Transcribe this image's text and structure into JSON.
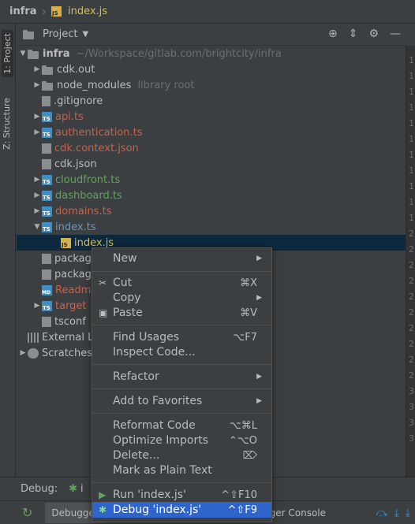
{
  "navbar": {
    "project": "infra",
    "file": "index.js"
  },
  "strip": {
    "project_tab": "1: Project",
    "structure_tab": "Z: Structure"
  },
  "project_panel": {
    "title": "Project"
  },
  "tree": [
    {
      "label": "infra",
      "hint": "~/Workspace/gitlab.com/brightcity/infra",
      "icon": "folder",
      "color": "#bbbbbb"
    },
    {
      "label": "cdk.out",
      "hint": "",
      "icon": "folder",
      "color": "#bbbbbb"
    },
    {
      "label": "node_modules",
      "hint": "library root",
      "icon": "folder",
      "color": "#bbbbbb"
    },
    {
      "label": ".gitignore",
      "hint": "",
      "icon": "blank",
      "color": "#bbbbbb"
    },
    {
      "label": "api.ts",
      "hint": "",
      "icon": "ts",
      "color": "#c7624b"
    },
    {
      "label": "authentication.ts",
      "hint": "",
      "icon": "ts",
      "color": "#c7624b"
    },
    {
      "label": "cdk.context.json",
      "hint": "",
      "icon": "json",
      "color": "#c7624b"
    },
    {
      "label": "cdk.json",
      "hint": "",
      "icon": "json",
      "color": "#bbbbbb"
    },
    {
      "label": "cloudfront.ts",
      "hint": "",
      "icon": "ts",
      "color": "#62a35c"
    },
    {
      "label": "dashboard.ts",
      "hint": "",
      "icon": "ts",
      "color": "#62a35c"
    },
    {
      "label": "domains.ts",
      "hint": "",
      "icon": "ts",
      "color": "#c7624b"
    },
    {
      "label": "index.ts",
      "hint": "",
      "icon": "ts",
      "color": "#6897bb"
    },
    {
      "label": "index.js",
      "hint": "",
      "icon": "js",
      "color": "#d6bf55"
    },
    {
      "label": "packag",
      "hint": "",
      "icon": "json",
      "color": "#bbbbbb"
    },
    {
      "label": "packag",
      "hint": "",
      "icon": "json",
      "color": "#bbbbbb"
    },
    {
      "label": "Readm",
      "hint": "",
      "icon": "md",
      "color": "#c7624b"
    },
    {
      "label": "target",
      "hint": "",
      "icon": "ts",
      "color": "#c7624b"
    },
    {
      "label": "tsconf",
      "hint": "",
      "icon": "json",
      "color": "#bbbbbb"
    },
    {
      "label": "External L",
      "hint": "",
      "icon": "lib",
      "color": "#bbbbbb"
    },
    {
      "label": "Scratches",
      "hint": "",
      "icon": "scratch",
      "color": "#bbbbbb"
    }
  ],
  "gutter": [
    "1",
    "1",
    "1",
    "1",
    "1",
    "1",
    "1",
    "1",
    "1",
    "1",
    "1",
    "2",
    "2",
    "2",
    "2",
    "2",
    "2",
    "2",
    "2",
    "2",
    "2",
    "3",
    "3",
    "3",
    "3"
  ],
  "debug": {
    "label": "Debug:",
    "tab": "i",
    "debugger_tab": "Debugger",
    "console_tab": "gger Console"
  },
  "menu": {
    "new": "New",
    "cut": "Cut",
    "cut_short": "⌘X",
    "copy": "Copy",
    "paste": "Paste",
    "paste_short": "⌘V",
    "find_usages": "Find Usages",
    "find_usages_short": "⌥F7",
    "inspect_code": "Inspect Code...",
    "refactor": "Refactor",
    "add_favorites": "Add to Favorites",
    "reformat": "Reformat Code",
    "reformat_short": "⌥⌘L",
    "optimize": "Optimize Imports",
    "optimize_short": "⌃⌥O",
    "delete": "Delete...",
    "delete_short": "⌦",
    "plain_text": "Mark as Plain Text",
    "run": "Run 'index.js'",
    "run_short": "^⇧F10",
    "debug": "Debug 'index.js'",
    "debug_short": "^⇧F9"
  }
}
